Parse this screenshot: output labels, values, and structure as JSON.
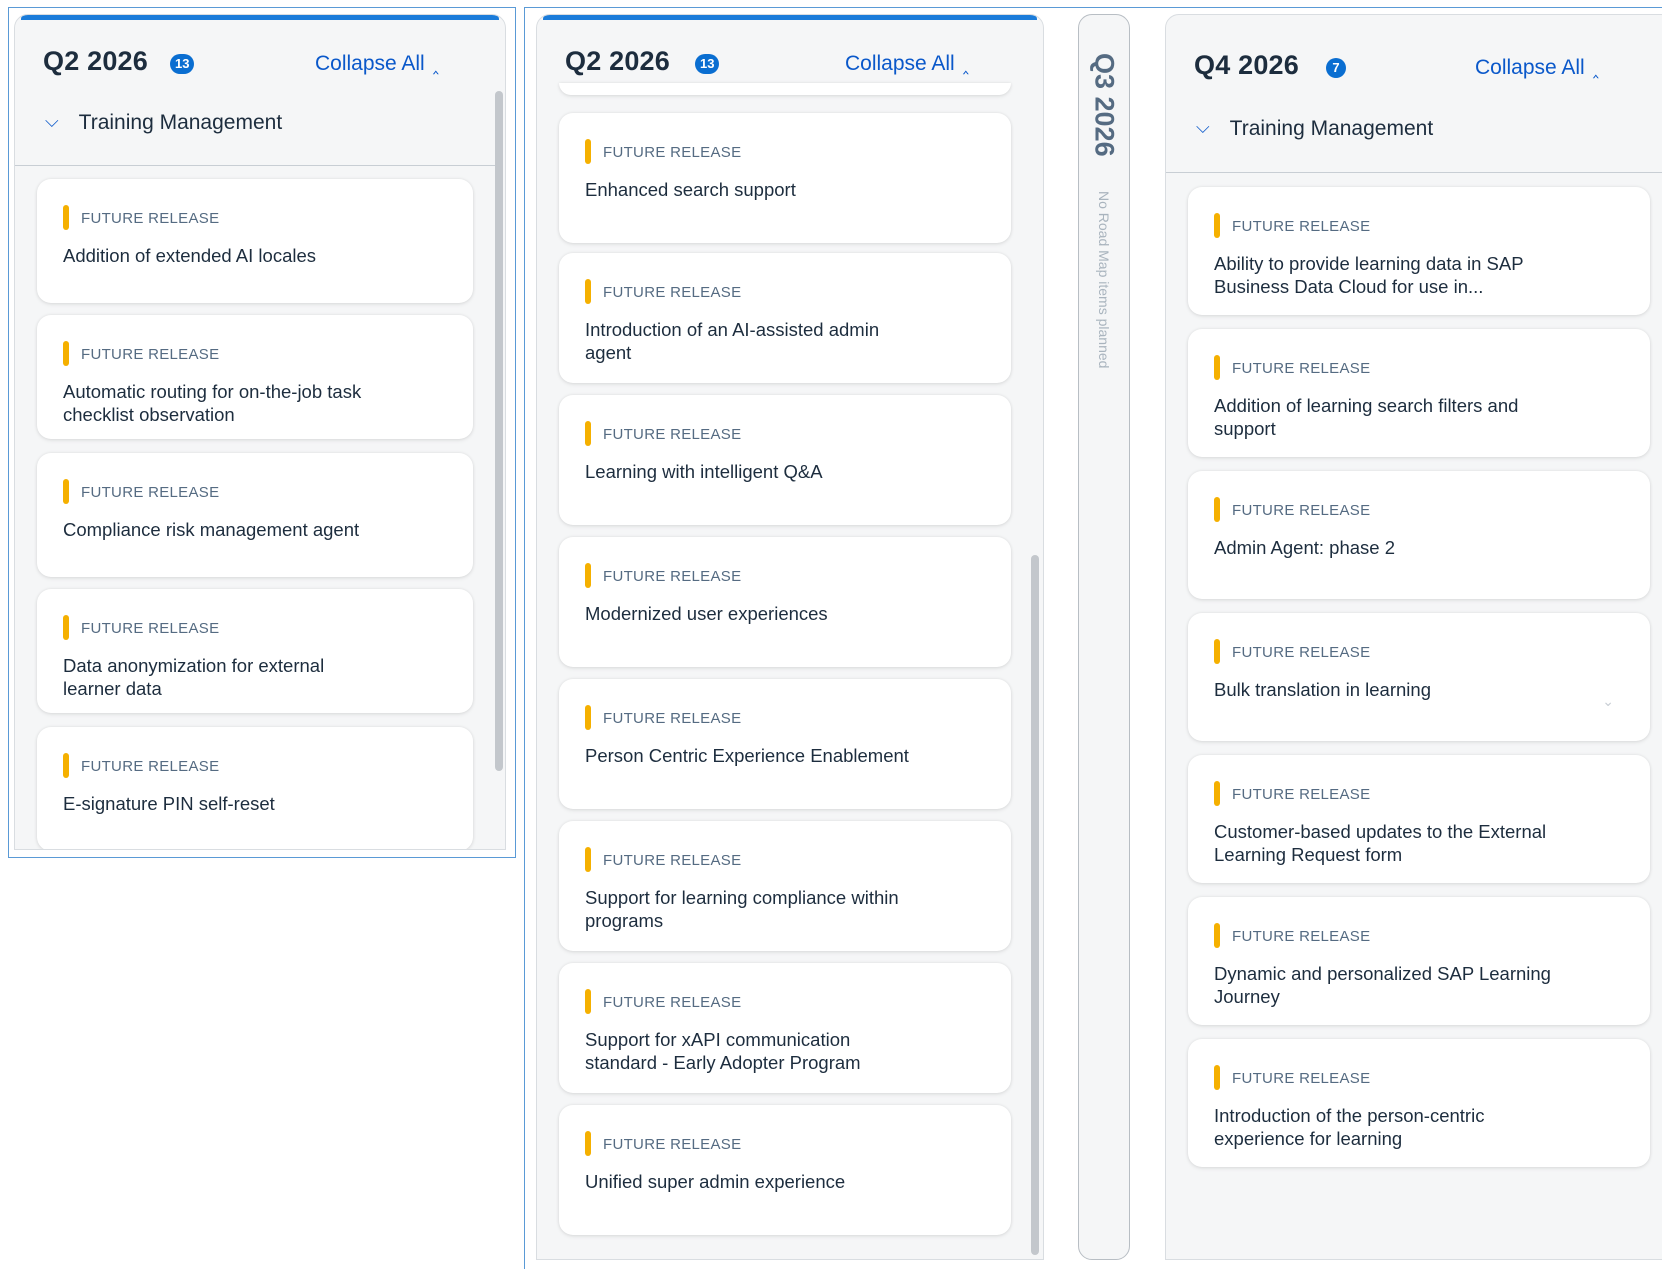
{
  "colors": {
    "accent": "#0a6ed1",
    "link": "#0a58ca",
    "flag": "#f5b000",
    "status_text": "#556b82",
    "column_bg": "#f5f6f7"
  },
  "icons": {
    "collapse": "double-chevron-up-icon",
    "group_toggle": "chevron-down-icon",
    "card_toggle": "chevron-down-icon"
  },
  "columns": [
    {
      "quarter": "Q2 2026",
      "count": "13",
      "collapse_label": "Collapse All",
      "group": "Training Management",
      "cards": [
        {
          "status": "FUTURE RELEASE",
          "title": "Addition of extended AI locales"
        },
        {
          "status": "FUTURE RELEASE",
          "title": "Automatic routing for on-the-job task checklist observation"
        },
        {
          "status": "FUTURE RELEASE",
          "title": "Compliance risk management agent"
        },
        {
          "status": "FUTURE RELEASE",
          "title": "Data anonymization for external learner data"
        },
        {
          "status": "FUTURE RELEASE",
          "title": "E-signature PIN self-reset"
        }
      ]
    },
    {
      "quarter": "Q2 2026",
      "count": "13",
      "collapse_label": "Collapse All",
      "cards": [
        {
          "status": "FUTURE RELEASE",
          "title": "Enhanced search support"
        },
        {
          "status": "FUTURE RELEASE",
          "title": "Introduction of an AI-assisted admin agent"
        },
        {
          "status": "FUTURE RELEASE",
          "title": "Learning with intelligent Q&A"
        },
        {
          "status": "FUTURE RELEASE",
          "title": "Modernized user experiences"
        },
        {
          "status": "FUTURE RELEASE",
          "title": "Person Centric Experience Enablement"
        },
        {
          "status": "FUTURE RELEASE",
          "title": "Support for learning compliance within programs"
        },
        {
          "status": "FUTURE RELEASE",
          "title": "Support for xAPI communication standard - Early Adopter Program"
        },
        {
          "status": "FUTURE RELEASE",
          "title": "Unified super admin experience"
        }
      ]
    },
    {
      "quarter": "Q3 2026",
      "note": "No Road Map items planned"
    },
    {
      "quarter": "Q4 2026",
      "count": "7",
      "collapse_label": "Collapse All",
      "group": "Training Management",
      "cards": [
        {
          "status": "FUTURE RELEASE",
          "title": "Ability to provide learning data in SAP Business Data Cloud for use in..."
        },
        {
          "status": "FUTURE RELEASE",
          "title": "Addition of learning search filters and support"
        },
        {
          "status": "FUTURE RELEASE",
          "title": "Admin Agent: phase 2"
        },
        {
          "status": "FUTURE RELEASE",
          "title": "Bulk translation in learning"
        },
        {
          "status": "FUTURE RELEASE",
          "title": "Customer-based updates to the External Learning Request form"
        },
        {
          "status": "FUTURE RELEASE",
          "title": "Dynamic and personalized SAP Learning Journey"
        },
        {
          "status": "FUTURE RELEASE",
          "title": "Introduction of the person-centric experience for learning"
        }
      ]
    }
  ]
}
